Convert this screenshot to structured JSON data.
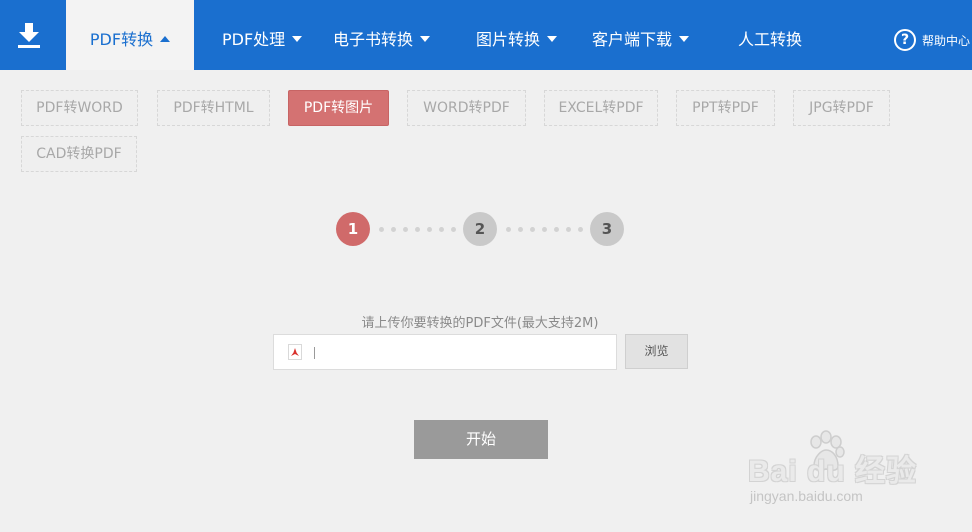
{
  "nav": {
    "items": [
      {
        "label": "PDF转换",
        "active": true
      },
      {
        "label": "PDF处理"
      },
      {
        "label": "电子书转换"
      },
      {
        "label": "图片转换"
      },
      {
        "label": "客户端下载"
      },
      {
        "label": "人工转换"
      }
    ],
    "help_label": "帮助中心"
  },
  "types": [
    {
      "label": "PDF转WORD"
    },
    {
      "label": "PDF转HTML"
    },
    {
      "label": "PDF转图片",
      "active": true
    },
    {
      "label": "WORD转PDF"
    },
    {
      "label": "EXCEL转PDF"
    },
    {
      "label": "PPT转PDF"
    },
    {
      "label": "JPG转PDF"
    },
    {
      "label": "CAD转换PDF"
    }
  ],
  "steps": [
    "1",
    "2",
    "3"
  ],
  "upload": {
    "label": "请上传你要转换的PDF文件(最大支持2M)",
    "browse_label": "浏览"
  },
  "start_label": "开始",
  "watermark": {
    "brand": "Bai du 经验",
    "url": "jingyan.baidu.com"
  },
  "colors": {
    "nav_blue": "#1a6fcf",
    "active_red": "#d47272",
    "step_active": "#d06a6a"
  }
}
